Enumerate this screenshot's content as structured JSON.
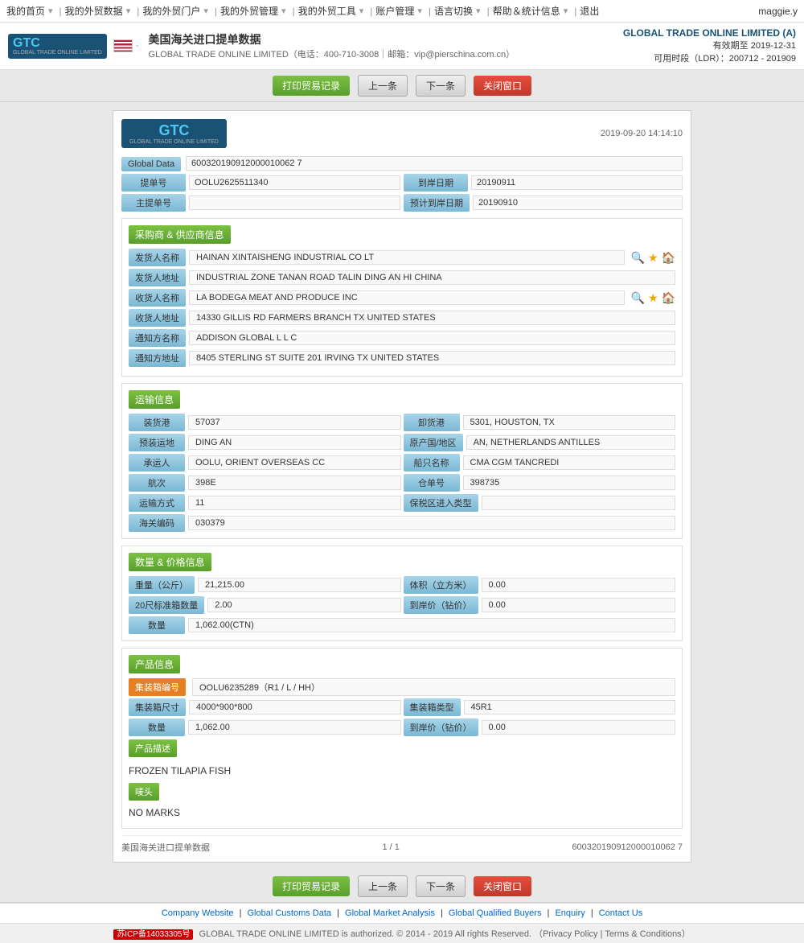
{
  "nav": {
    "items": [
      {
        "label": "我的首页",
        "has_dropdown": false
      },
      {
        "label": "我的外贸数据",
        "has_dropdown": true
      },
      {
        "label": "我的外贸门户",
        "has_dropdown": true
      },
      {
        "label": "我的外贸管理",
        "has_dropdown": true
      },
      {
        "label": "我的外贸工具",
        "has_dropdown": true
      },
      {
        "label": "账户管理",
        "has_dropdown": true
      },
      {
        "label": "语言切换",
        "has_dropdown": true
      },
      {
        "label": "帮助＆统计信息",
        "has_dropdown": true
      },
      {
        "label": "退出",
        "has_dropdown": false
      }
    ],
    "user": "maggie.y"
  },
  "header": {
    "country": "美国",
    "title": "美国海关进口提单数据",
    "company": "GLOBAL TRADE ONLINE LIMITED",
    "phone": "400-710-3008",
    "email": "vip@pierschina.com.cn",
    "brand": "GLOBAL TRADE ONLINE LIMITED (A)",
    "valid_until": "有效期至 2019-12-31",
    "ldr": "可用时段（LDR）：200712 - 201909"
  },
  "toolbar": {
    "print_label": "打印贸易记录",
    "prev_label": "上一条",
    "next_label": "下一条",
    "close_label": "关闭窗口"
  },
  "doc": {
    "datetime": "2019-09-20 14:14:10",
    "global_data_label": "Global Data",
    "global_data_value": "600320190912000010062 7",
    "bill_no_label": "提单号",
    "bill_no_value": "OOLU2625511340",
    "arrival_date_label": "到岸日期",
    "arrival_date_value": "20190911",
    "main_bill_label": "主提单号",
    "main_bill_value": "",
    "est_arrival_label": "预计到岸日期",
    "est_arrival_value": "20190910"
  },
  "supplier": {
    "section_label": "采购商 & 供应商信息",
    "shipper_name_label": "发货人名称",
    "shipper_name_value": "HAINAN XINTAISHENG INDUSTRIAL CO LT",
    "shipper_addr_label": "发货人地址",
    "shipper_addr_value": "INDUSTRIAL ZONE TANAN ROAD TALIN DING AN HI CHINA",
    "consignee_name_label": "收货人名称",
    "consignee_name_value": "LA BODEGA MEAT AND PRODUCE INC",
    "consignee_addr_label": "收货人地址",
    "consignee_addr_value": "14330 GILLIS RD FARMERS BRANCH TX UNITED STATES",
    "notify_name_label": "通知方名称",
    "notify_name_value": "ADDISON GLOBAL L L C",
    "notify_addr_label": "通知方地址",
    "notify_addr_value": "8405 STERLING ST SUITE 201 IRVING TX UNITED STATES"
  },
  "transport": {
    "section_label": "运输信息",
    "origin_port_label": "装货港",
    "origin_port_value": "57037",
    "dest_port_label": "卸货港",
    "dest_port_value": "5301, HOUSTON, TX",
    "loading_place_label": "预装运地",
    "loading_place_value": "DING AN",
    "origin_country_label": "原产国/地区",
    "origin_country_value": "AN, NETHERLANDS ANTILLES",
    "carrier_label": "承运人",
    "carrier_value": "OOLU, ORIENT OVERSEAS CC",
    "vessel_label": "船只名称",
    "vessel_value": "CMA CGM TANCREDI",
    "voyage_label": "航次",
    "voyage_value": "398E",
    "warehouse_label": "仓单号",
    "warehouse_value": "398735",
    "transport_mode_label": "运输方式",
    "transport_mode_value": "11",
    "bonded_label": "保税区进入类型",
    "bonded_value": "",
    "customs_label": "海关编码",
    "customs_value": "030379"
  },
  "quantity": {
    "section_label": "数量 & 价格信息",
    "weight_label": "重量（公斤）",
    "weight_value": "21,215.00",
    "volume_label": "体积（立方米）",
    "volume_value": "0.00",
    "containers_20_label": "20尺标准箱数量",
    "containers_20_value": "2.00",
    "price_label": "到岸价（钻价）",
    "price_value": "0.00",
    "qty_label": "数量",
    "qty_value": "1,062.00(CTN)"
  },
  "product": {
    "section_label": "产品信息",
    "container_no_label": "集装箱编号",
    "container_no_value": "OOLU6235289（R1 / L / HH）",
    "container_size_label": "集装箱尺寸",
    "container_size_value": "4000*900*800",
    "container_type_label": "集装箱类型",
    "container_type_value": "45R1",
    "qty_label": "数量",
    "qty_value": "1,062.00",
    "price_label": "到岸价（钻价）",
    "price_value": "0.00",
    "desc_label": "产品描述",
    "desc_value": "FROZEN TILAPIA FISH",
    "marks_label": "唛头",
    "marks_value": "NO MARKS"
  },
  "footer_doc": {
    "source": "美国海关进口提单数据",
    "page": "1 / 1",
    "record_id": "600320190912000010062 7"
  },
  "footer": {
    "links": [
      {
        "label": "Company Website"
      },
      {
        "label": "Global Customs Data"
      },
      {
        "label": "Global Market Analysis"
      },
      {
        "label": "Global Qualified Buyers"
      },
      {
        "label": "Enquiry"
      },
      {
        "label": "Contact Us"
      }
    ],
    "copyright": "GLOBAL TRADE ONLINE LIMITED is authorized. © 2014 - 2019 All rights Reserved.",
    "privacy": "Privacy Policy",
    "terms": "Terms & Conditions",
    "icp": "苏ICP备14033305号"
  }
}
